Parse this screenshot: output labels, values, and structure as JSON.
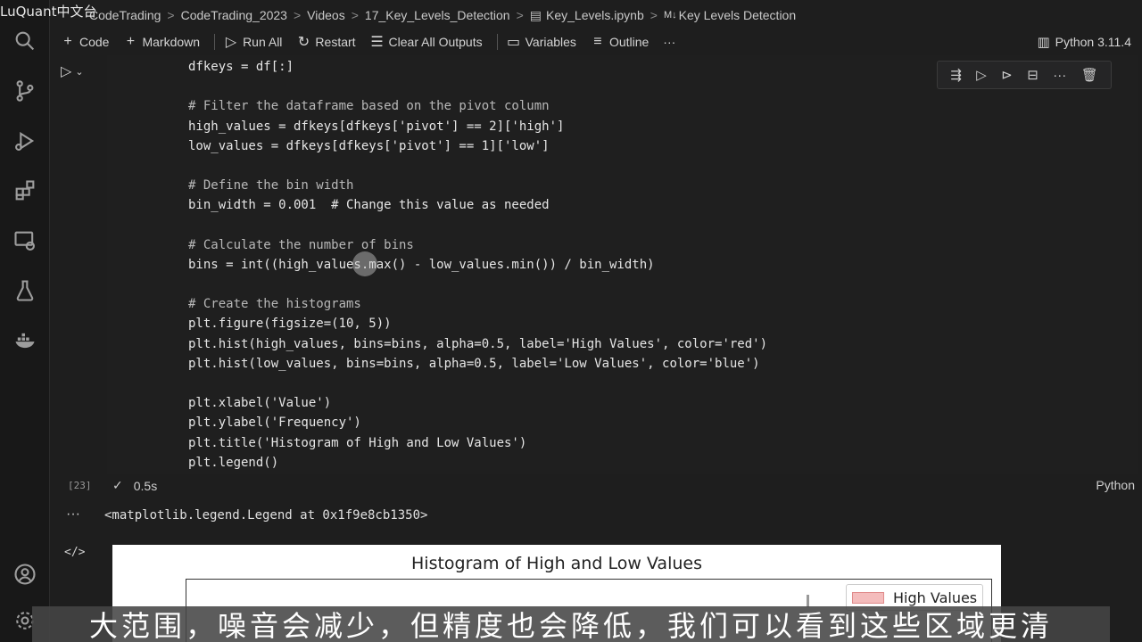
{
  "watermark": "LuQuant中文台",
  "breadcrumb": {
    "items": [
      "CodeTrading",
      "CodeTrading_2023",
      "Videos",
      "17_Key_Levels_Detection",
      "Key_Levels.ipynb",
      "Key Levels Detection"
    ],
    "separator": ">",
    "notebook_badge": "M↓"
  },
  "toolbar": {
    "code": "Code",
    "markdown": "Markdown",
    "run_all": "Run All",
    "restart": "Restart",
    "clear_outputs": "Clear All Outputs",
    "variables": "Variables",
    "outline": "Outline",
    "more": "···",
    "kernel": "Python 3.11.4"
  },
  "cell": {
    "code_lines": [
      "dfkeys = df[:]",
      "",
      "# Filter the dataframe based on the pivot column",
      "high_values = dfkeys[dfkeys['pivot'] == 2]['high']",
      "low_values = dfkeys[dfkeys['pivot'] == 1]['low']",
      "",
      "# Define the bin width",
      "bin_width = 0.001  # Change this value as needed",
      "",
      "# Calculate the number of bins",
      "bins = int((high_values.max() - low_values.min()) / bin_width)",
      "",
      "# Create the histograms",
      "plt.figure(figsize=(10, 5))",
      "plt.hist(high_values, bins=bins, alpha=0.5, label='High Values', color='red')",
      "plt.hist(low_values, bins=bins, alpha=0.5, label='Low Values', color='blue')",
      "",
      "plt.xlabel('Value')",
      "plt.ylabel('Frequency')",
      "plt.title('Histogram of High and Low Values')",
      "plt.legend()"
    ],
    "exec_count": "[23]",
    "exec_time": "0.5s",
    "language": "Python"
  },
  "output": {
    "text": "<matplotlib.legend.Legend at 0x1f9e8cb1350>",
    "ellipsis": "···",
    "code_icon": "</>"
  },
  "plot": {
    "title": "Histogram of High and Low Values",
    "legend_label": "High Values",
    "swatch_color": "#f4bcbc"
  },
  "subtitle": "大范围，噪音会减少，但精度也会降低，我们可以看到这些区域更清"
}
